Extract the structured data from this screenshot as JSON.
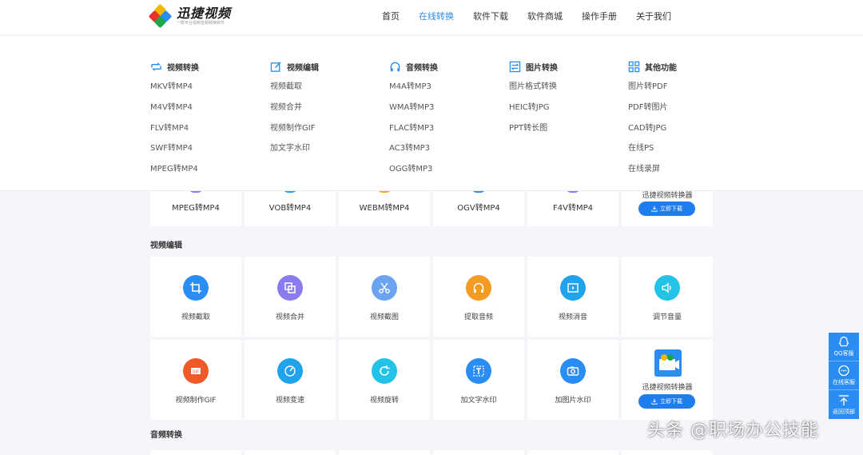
{
  "header": {
    "logo_title": "迅捷视频",
    "logo_subtitle": "一款专业视频音频转换软件",
    "nav": [
      {
        "label": "首页",
        "active": false
      },
      {
        "label": "在线转换",
        "active": true
      },
      {
        "label": "软件下载",
        "active": false
      },
      {
        "label": "软件商城",
        "active": false
      },
      {
        "label": "操作手册",
        "active": false
      },
      {
        "label": "关于我们",
        "active": false
      }
    ]
  },
  "dropdown": {
    "columns": [
      {
        "title": "视频转换",
        "icon": "video-convert-icon",
        "items": [
          "MKV转MP4",
          "M4V转MP4",
          "FLV转MP4",
          "SWF转MP4",
          "MPEG转MP4"
        ]
      },
      {
        "title": "视频编辑",
        "icon": "edit-icon",
        "items": [
          "视频截取",
          "视频合并",
          "视频制作GIF",
          "加文字水印"
        ]
      },
      {
        "title": "音频转换",
        "icon": "headphones-icon",
        "items": [
          "M4A转MP3",
          "WMA转MP3",
          "FLAC转MP3",
          "AC3转MP3",
          "OGG转MP3"
        ]
      },
      {
        "title": "图片转换",
        "icon": "image-convert-icon",
        "items": [
          "图片格式转换",
          "HEIC转JPG",
          "PPT转长图"
        ]
      },
      {
        "title": "其他功能",
        "icon": "grid-icon",
        "items": [
          "图片转PDF",
          "PDF转图片",
          "CAD转JPG",
          "在线PS",
          "在线录屏"
        ]
      }
    ]
  },
  "content": {
    "row1": [
      {
        "label": "MPEG转MP4",
        "color": "#8a7cf0"
      },
      {
        "label": "VOB转MP4",
        "color": "#2a9df4"
      },
      {
        "label": "WEBM转MP4",
        "color": "#f5a623"
      },
      {
        "label": "OGV转MP4",
        "color": "#2a8cf5"
      },
      {
        "label": "F4V转MP4",
        "color": "#8a7cf0"
      }
    ],
    "row1_promo": {
      "title": "迅捷视频转换器",
      "button": "立即下载"
    },
    "section_video_edit": "视频编辑",
    "row2": [
      {
        "label": "视频截取",
        "color": "#2a8cf5",
        "icon": "crop-icon"
      },
      {
        "label": "视频合并",
        "color": "#8a7cf0",
        "icon": "merge-icon"
      },
      {
        "label": "视频截图",
        "color": "#6aa3f0",
        "icon": "scissors-icon"
      },
      {
        "label": "提取音频",
        "color": "#f59a23",
        "icon": "headphones-icon"
      },
      {
        "label": "视频消音",
        "color": "#1fa3ec",
        "icon": "play-icon"
      },
      {
        "label": "调节音量",
        "color": "#22c3e6",
        "icon": "volume-icon"
      }
    ],
    "row3": [
      {
        "label": "视频制作GIF",
        "color": "#f05a28",
        "icon": "gif-icon"
      },
      {
        "label": "视频变速",
        "color": "#1fa3ec",
        "icon": "speed-icon"
      },
      {
        "label": "视频旋转",
        "color": "#22c3e6",
        "icon": "rotate-icon"
      },
      {
        "label": "加文字水印",
        "color": "#2a8cf5",
        "icon": "text-watermark-icon"
      },
      {
        "label": "加图片水印",
        "color": "#2a8cf5",
        "icon": "image-watermark-icon"
      }
    ],
    "row3_promo": {
      "title": "迅捷视频转换器",
      "button": "立即下载"
    },
    "section_audio": "音频转换"
  },
  "side": {
    "items": [
      {
        "label": "QQ客服",
        "icon": "qq-icon"
      },
      {
        "label": "在线客服",
        "icon": "chat-icon"
      },
      {
        "label": "返回顶部",
        "icon": "back-to-top-icon"
      }
    ]
  },
  "watermark": "头条 @职场办公技能",
  "colors": {
    "accent": "#2a8cf5",
    "button": "#1e7ef0",
    "background": "#f4f6fa"
  }
}
